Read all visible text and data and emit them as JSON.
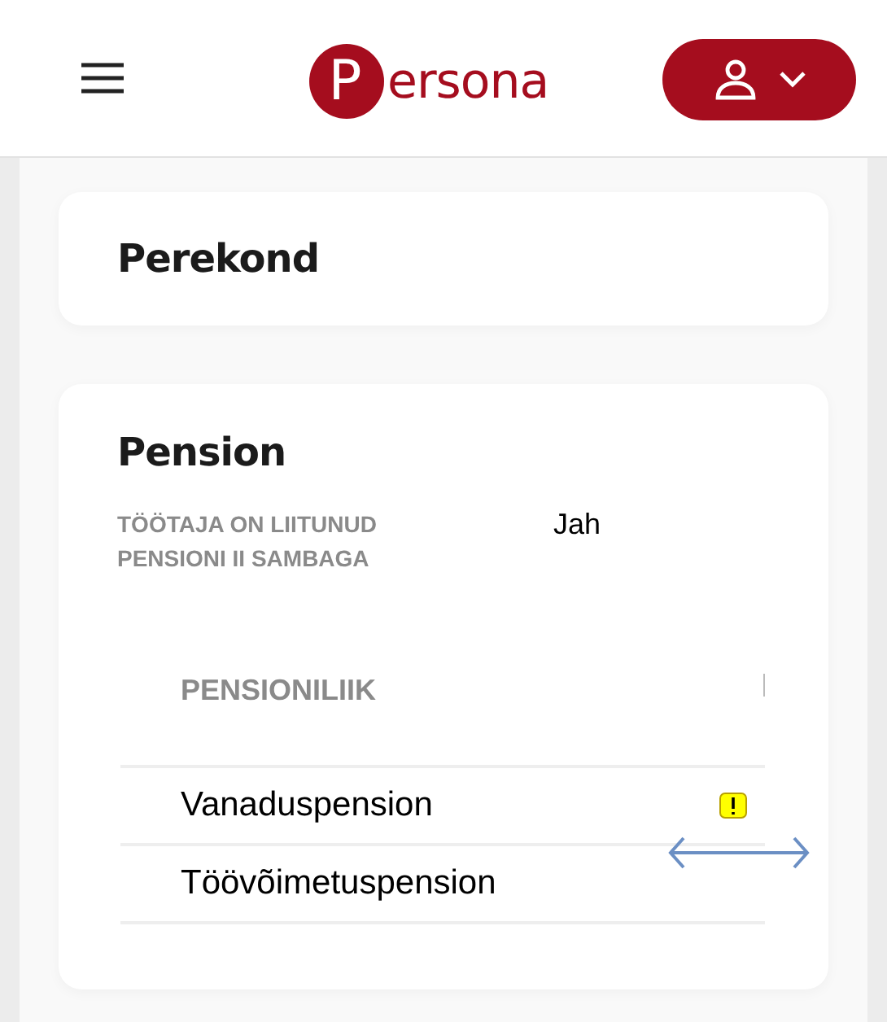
{
  "header": {
    "logo_initial": "P",
    "logo_text": "ersona"
  },
  "sections": [
    {
      "title": "Perekond"
    },
    {
      "title": "Pension",
      "fields": [
        {
          "label": "TÖÖTAJA ON LIITUNUD PENSIONI II SAMBAGA",
          "value": "Jah"
        }
      ],
      "table": {
        "columns": [
          "PENSIONILIIK"
        ],
        "rows": [
          {
            "type": "Vanaduspension",
            "warning": true
          },
          {
            "type": "Töövõimetuspension",
            "warning": false
          }
        ]
      }
    }
  ]
}
